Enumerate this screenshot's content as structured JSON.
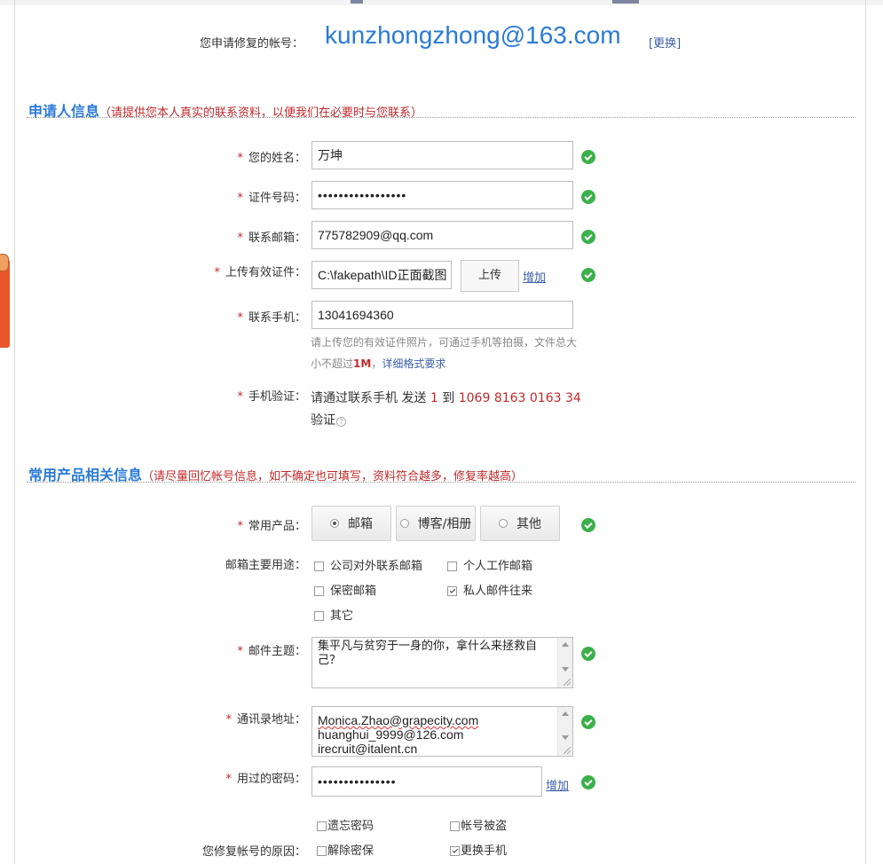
{
  "account": {
    "label": "您申请修复的帐号：",
    "email": "kunzhongzhong@163.com",
    "change": "[更换]"
  },
  "section1": {
    "title": "申请人信息",
    "note": "（请提供您本人真实的联系资料，以便我们在必要时与您联系）"
  },
  "fields": {
    "name": {
      "label": "您的姓名：",
      "value": "万坤"
    },
    "id_number": {
      "label": "证件号码：",
      "value": "•••••••••••••••••"
    },
    "contact_email": {
      "label": "联系邮箱：",
      "value": "775782909@qq.com"
    },
    "upload": {
      "label": "上传有效证件：",
      "value": "C:\\fakepath\\ID正面截图",
      "button": "上传",
      "add": "增加"
    },
    "phone": {
      "label": "联系手机：",
      "value": "13041694360"
    },
    "hint": {
      "text1": "请上传您的有效证件照片，可通过手机等拍摄，文件总大小不超过",
      "size": "1M",
      "sep": "，",
      "link": "详细格式要求"
    },
    "sms": {
      "label": "手机验证：",
      "text1": "请通过联系手机 发送 ",
      "code": "1",
      "text2": " 到 ",
      "number": "1069 8163 0163 34",
      "text3": "验证"
    }
  },
  "section2": {
    "title": "常用产品相关信息",
    "note": "（请尽量回忆帐号信息，如不确定也可填写，资料符合越多，修复率越高）"
  },
  "product": {
    "label": "常用产品：",
    "options": [
      "邮箱",
      "博客/相册",
      "其他"
    ],
    "selected": "邮箱"
  },
  "usage": {
    "label": "邮箱主要用途：",
    "options": [
      {
        "label": "公司对外联系邮箱",
        "checked": false
      },
      {
        "label": "个人工作邮箱",
        "checked": false
      },
      {
        "label": "保密邮箱",
        "checked": false
      },
      {
        "label": "私人邮件往来",
        "checked": true
      },
      {
        "label": "其它",
        "checked": false
      }
    ]
  },
  "subject": {
    "label": "邮件主题：",
    "value": "集平凡与贫穷于一身的你，拿什么来拯救自己？"
  },
  "contacts": {
    "label": "通讯录地址：",
    "lines": [
      "Monica.Zhao@grapecity.com",
      "huanghui_9999@126.com",
      "irecruit@italent.cn"
    ]
  },
  "passwords": {
    "label": "用过的密码：",
    "value": "•••••••••••••••",
    "add": "增加"
  },
  "reason": {
    "label": "您修复帐号的原因：",
    "options": [
      {
        "label": "遗忘密码",
        "checked": false
      },
      {
        "label": "帐号被盗",
        "checked": false
      },
      {
        "label": "解除密保",
        "checked": false
      },
      {
        "label": "更换手机",
        "checked": true
      }
    ]
  },
  "colors": {
    "accent": "#2a7bd6",
    "required": "#c0282a",
    "ok": "#3cb04a"
  }
}
